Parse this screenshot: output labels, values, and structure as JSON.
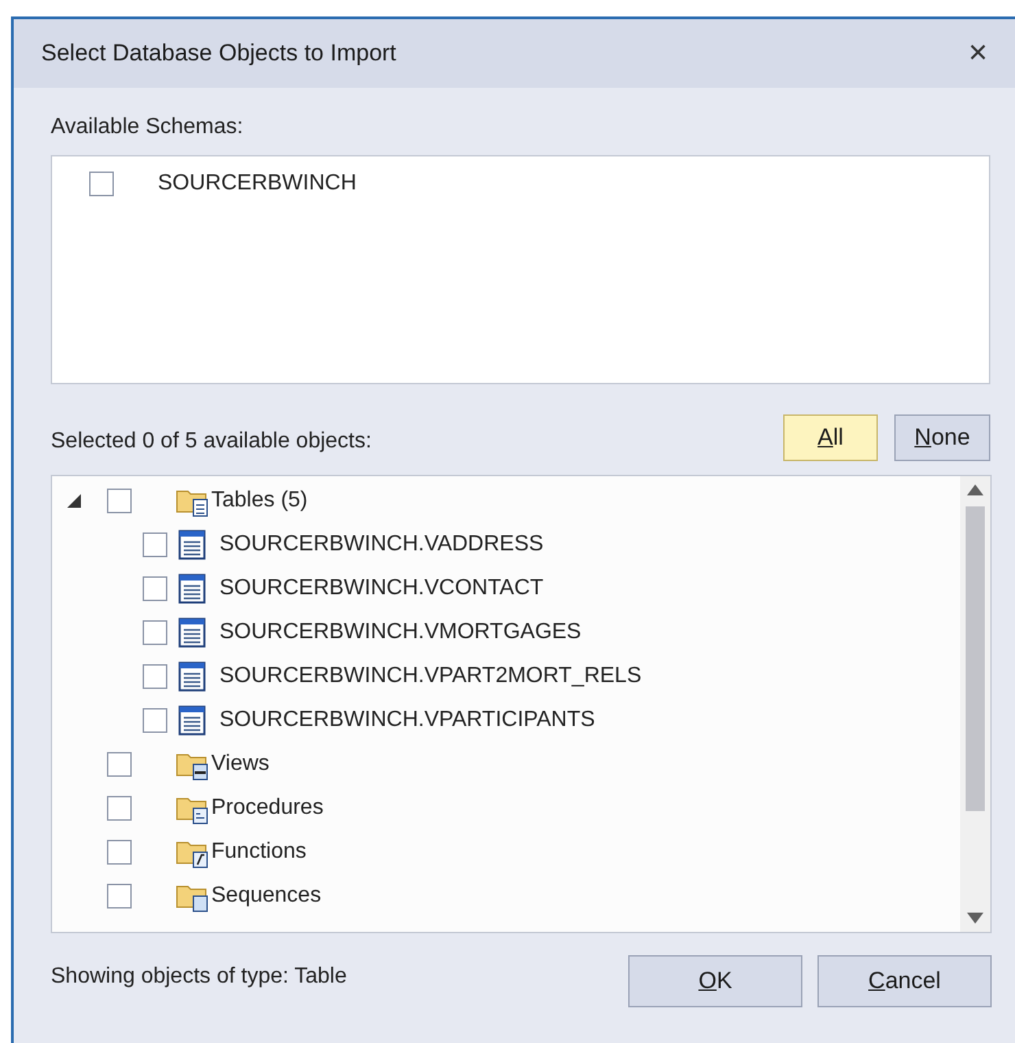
{
  "window": {
    "title": "Select Database Objects to Import",
    "close": "×"
  },
  "schemas": {
    "label": "Available Schemas:",
    "items": [
      {
        "name": "SOURCERBWINCH",
        "checked": false
      }
    ]
  },
  "selection_summary": "Selected 0 of 5 available objects:",
  "buttons_top": [
    {
      "label": "All",
      "mnemonic": true,
      "highlighted": true
    },
    {
      "label": "None",
      "mnemonic": true,
      "highlighted": false
    }
  ],
  "tree": [
    {
      "label": "Tables (5)",
      "kind": "tables",
      "checked": false,
      "expanded": true,
      "children": [
        {
          "label": "SOURCERBWINCH.VADDRESS",
          "kind": "table",
          "checked": false
        },
        {
          "label": "SOURCERBWINCH.VCONTACT",
          "kind": "table",
          "checked": false
        },
        {
          "label": "SOURCERBWINCH.VMORTGAGES",
          "kind": "table",
          "checked": false
        },
        {
          "label": "SOURCERBWINCH.VPART2MORT_RELS",
          "kind": "table",
          "checked": false
        },
        {
          "label": "SOURCERBWINCH.VPARTICIPANTS",
          "kind": "table",
          "checked": false
        }
      ]
    },
    {
      "label": "Views",
      "kind": "views",
      "checked": false,
      "expanded": false
    },
    {
      "label": "Procedures",
      "kind": "procedures",
      "checked": false,
      "expanded": false
    },
    {
      "label": "Functions",
      "kind": "functions",
      "checked": false,
      "expanded": false
    },
    {
      "label": "Sequences",
      "kind": "sequences",
      "checked": false,
      "expanded": false
    }
  ],
  "status": "Showing objects of type: Table",
  "buttons_bottom": [
    {
      "label": "OK",
      "mnemonic": true,
      "highlighted": false
    },
    {
      "label": "Cancel",
      "mnemonic": true,
      "highlighted": false
    }
  ]
}
